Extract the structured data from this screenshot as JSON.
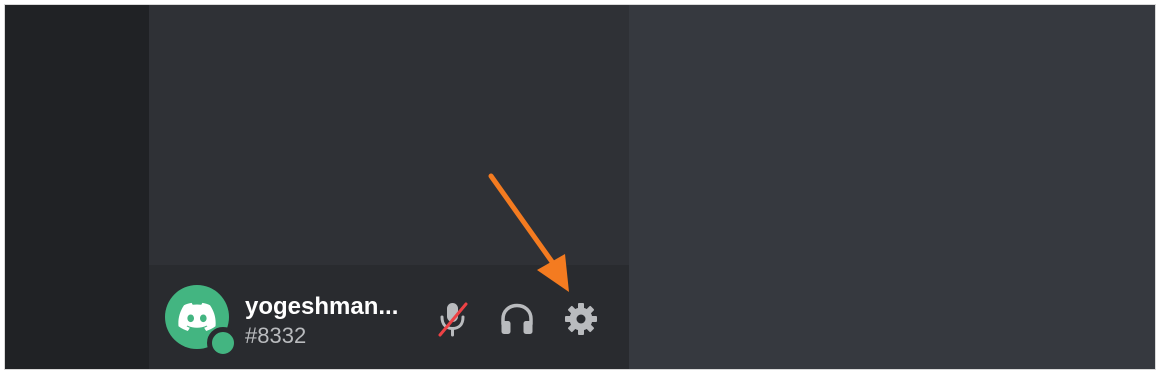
{
  "user_panel": {
    "username": "yogeshman...",
    "discriminator": "#8332",
    "avatar_icon": "discord-logo-icon",
    "avatar_color": "#43b581",
    "status": "online",
    "status_color": "#43b581"
  },
  "controls": {
    "mute": {
      "icon": "microphone-muted-icon",
      "state": "muted",
      "slash_color": "#ed4245"
    },
    "deafen": {
      "icon": "headphones-icon"
    },
    "settings": {
      "icon": "gear-icon"
    }
  },
  "annotation": {
    "icon": "arrow-icon",
    "color": "#f47b20"
  }
}
